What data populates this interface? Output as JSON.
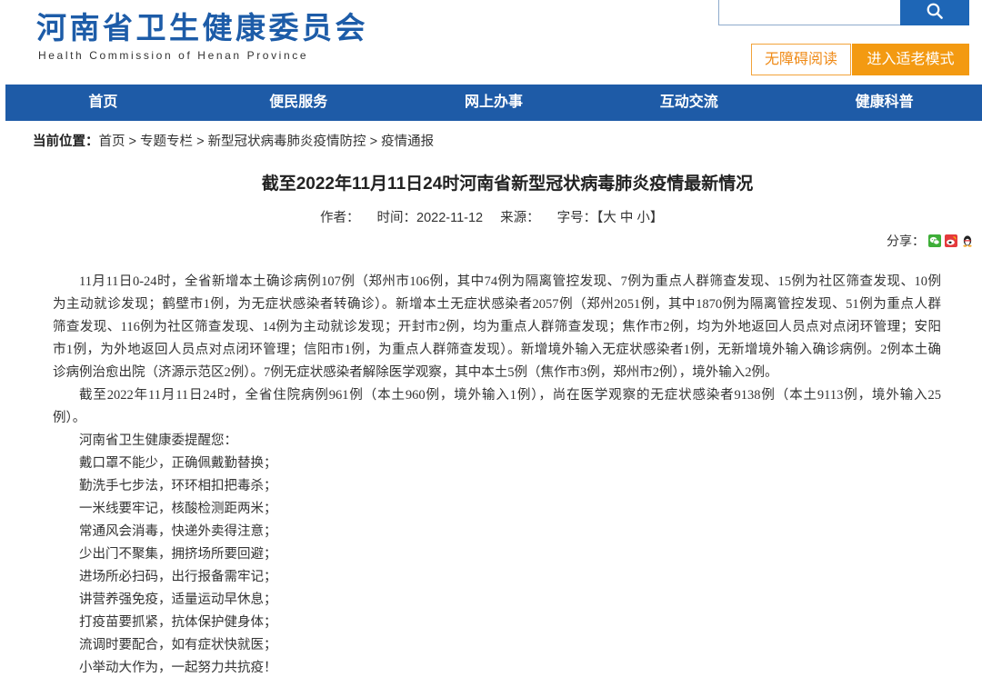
{
  "site": {
    "name_cn": "河南省卫生健康委员会",
    "name_en": "Health Commission of Henan Province"
  },
  "tools": {
    "accessible_label": "无障碍阅读",
    "elderly_label": "进入适老模式"
  },
  "nav": {
    "items": [
      {
        "label": "首页"
      },
      {
        "label": "便民服务"
      },
      {
        "label": "网上办事"
      },
      {
        "label": "互动交流"
      },
      {
        "label": "健康科普"
      }
    ]
  },
  "breadcrumb": {
    "label": "当前位置：",
    "separator": ">",
    "items": [
      "首页",
      "专题专栏",
      "新型冠状病毒肺炎疫情防控",
      "疫情通报"
    ]
  },
  "article": {
    "title": "截至2022年11月11日24时河南省新型冠状病毒肺炎疫情最新情况",
    "meta": {
      "author_label": "作者：",
      "time_label": "时间：",
      "time": "2022-11-12",
      "source_label": "来源：",
      "fontsize_label": "字号：",
      "bracket_open": "【",
      "fontsize_options": [
        "大",
        "中",
        "小"
      ],
      "bracket_close": "】"
    },
    "share": {
      "label": "分享：",
      "icons": [
        "wechat-icon",
        "weibo-icon",
        "qq-icon"
      ]
    },
    "body": {
      "paragraphs": [
        {
          "lines": [
            "11月11日0-24时，全省新增本土确诊病例107例（郑州市106例，其中74例为隔离管控发现、7例为重点人群筛查发现、15例为社区筛查发现、10例",
            "为主动就诊发现；鹤壁市1例，为无症状感染者转确诊）。新增本土无症状感染者2057例（郑州2051例，其中1870例为隔离管控发现、51例为重点人群",
            "筛查发现、116例为社区筛查发现、14例为主动就诊发现；开封市2例，均为重点人群筛查发现；焦作市2例，均为外地返回人员点对点闭环管理；安阳",
            "市1例，为外地返回人员点对点闭环管理；信阳市1例，为重点人群筛查发现）。新增境外输入无症状感染者1例，无新增境外输入确诊病例。2例本土确",
            "诊病例治愈出院（济源示范区2例）。7例无症状感染者解除医学观察，其中本土5例（焦作市3例，郑州市2例），境外输入2例。"
          ]
        },
        {
          "lines": [
            "截至2022年11月11日24时，全省住院病例961例（本土960例，境外输入1例），尚在医学观察的无症状感染者9138例（本土9113例，境外输入25",
            "例）。"
          ]
        }
      ],
      "reminder": {
        "intro": "河南省卫生健康委提醒您：",
        "verses": [
          "戴口罩不能少，正确佩戴勤替换；",
          "勤洗手七步法，环环相扣把毒杀；",
          "一米线要牢记，核酸检测距两米；",
          "常通风会消毒，快递外卖得注意；",
          "少出门不聚集，拥挤场所要回避；",
          "进场所必扫码，出行报备需牢记；",
          "讲营养强免疫，适量运动早休息；",
          "打疫苗要抓紧，抗体保护健身体；",
          "流调时要配合，如有症状快就医；",
          "小举动大作为，一起努力共抗疫！"
        ]
      }
    }
  },
  "icons": {
    "search_button": "search-icon"
  },
  "colors": {
    "brand_blue": "#1d5ca8",
    "nav_blue": "#1e5ba7",
    "search_button": "#1e66b6",
    "accent_orange": "#f39a12",
    "text": "#333333"
  }
}
